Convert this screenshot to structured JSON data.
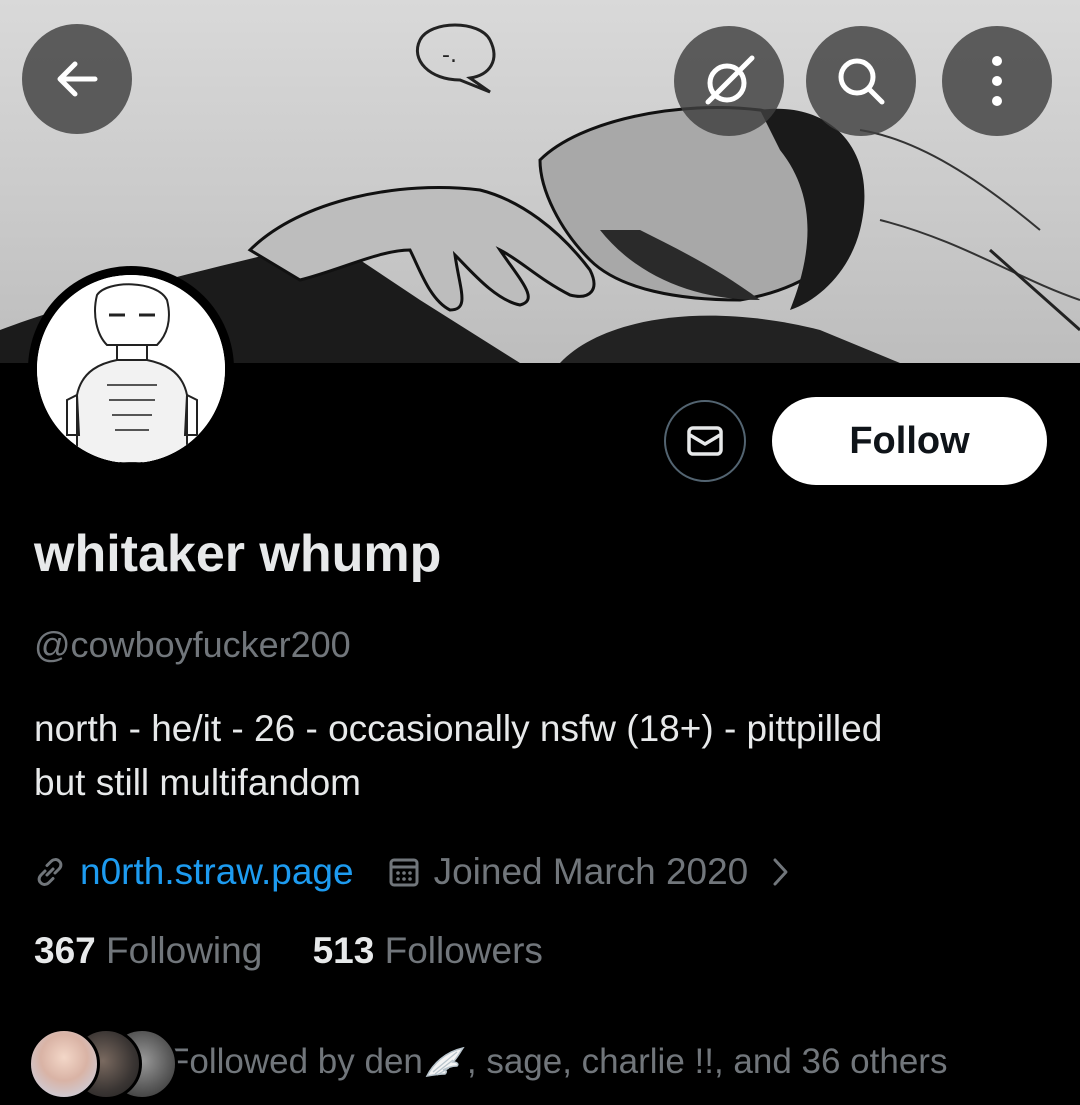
{
  "header": {
    "back_icon": "arrow-left-icon",
    "grok_icon": "grok-icon",
    "search_icon": "search-icon",
    "more_icon": "more-vertical-icon"
  },
  "profile": {
    "display_name": "whitaker whump",
    "handle": "@cowboyfucker200",
    "bio_line1": "north - he/it - 26 - occasionally nsfw (18+) - pittpilled",
    "bio_line2": "but still multifandom",
    "website": "n0rth.straw.page",
    "joined": "Joined March 2020",
    "following_count": "367",
    "following_label": "Following",
    "followers_count": "513",
    "followers_label": "Followers",
    "followed_by_prefix": "Followed by den",
    "followed_by_suffix": ", sage, charlie !!, and 36 others"
  },
  "actions": {
    "follow_label": "Follow",
    "message_icon": "envelope-icon"
  },
  "colors": {
    "background": "#000000",
    "text_primary": "#e7e9ea",
    "text_secondary": "#71767b",
    "link": "#1d9bf0",
    "follow_bg": "#ffffff"
  }
}
